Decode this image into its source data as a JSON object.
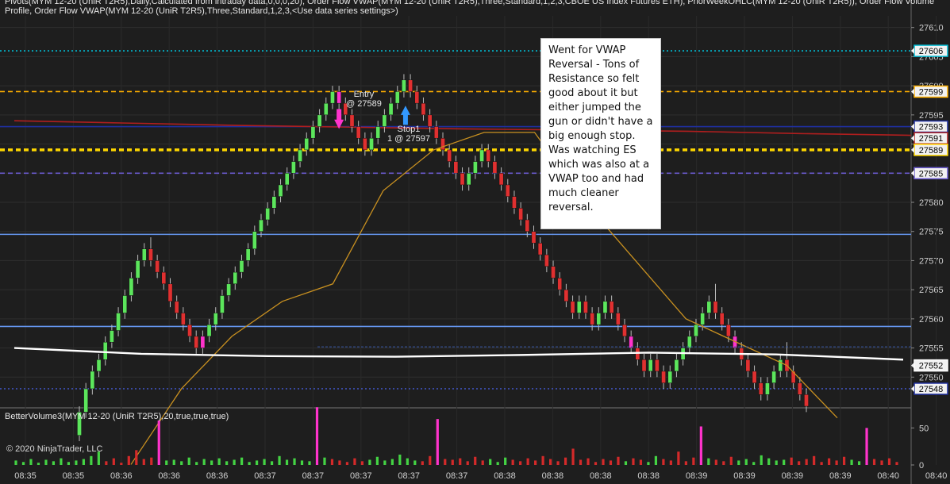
{
  "header": {
    "legend_line1": "Pivots(MYM 12-20 (UniR T2R5),Daily,Calculated from intraday data,0,0,0,20), Order Flow VWAP(MYM 12-20 (UniR T2R5),Three,Standard,1,2,3,CBOE US Index Futures ETH), PriorWeekOHLC(MYM 12-20 (UniR T2R5)), Order Flow Volume",
    "legend_line2": "Profile, Order Flow VWAP(MYM 12-20 (UniR T2R5),Three,Standard,1,2,3,<Use data series settings>)"
  },
  "note": {
    "text": "Went for VWAP Reversal - Tons of Resistance so felt good about it but either jumped the gun or didn't have a big enough stop. Was watching ES which was also at a VWAP too and had much cleaner reversal."
  },
  "annotations": {
    "entry": "Entry\n@ 27589",
    "stop": "Stop1\n1 @ 27597"
  },
  "volume_panel": {
    "title": "BetterVolume3(MYM 12-20 (UniR T2R5),20,true,true,true)"
  },
  "copyright": "© 2020 NinjaTrader, LLC",
  "chart_data": {
    "type": "candlestick",
    "price_axis": {
      "ylim": [
        27545,
        27612
      ],
      "tick_labels": [
        "27610",
        "27605",
        "27600",
        "27595",
        "27590",
        "27585",
        "27580",
        "27575",
        "27570",
        "27565",
        "27560",
        "27555",
        "27550"
      ],
      "ticks": [
        27610,
        27605,
        27600,
        27595,
        27590,
        27585,
        27580,
        27575,
        27570,
        27565,
        27560,
        27555,
        27550
      ]
    },
    "price_markers": [
      {
        "label": "27606",
        "value": 27606,
        "color": "#00bcd4"
      },
      {
        "label": "27599",
        "value": 27599,
        "color": "#ffb000"
      },
      {
        "label": "27593",
        "value": 27593,
        "color": "#1f2fa0"
      },
      {
        "label": "27591",
        "value": 27591,
        "color": "#b22222"
      },
      {
        "label": "27589",
        "value": 27589,
        "color": "#ffd700"
      },
      {
        "label": "27585",
        "value": 27585,
        "color": "#6a5acd"
      },
      {
        "label": "27552",
        "value": 27552,
        "color": "#ffffff"
      },
      {
        "label": "27548",
        "value": 27548,
        "color": "#1f2fa0"
      }
    ],
    "horizontal_lines": [
      {
        "value": 27606,
        "color": "#00bcd4",
        "style": "dotted"
      },
      {
        "value": 27599,
        "color": "#ffb000",
        "style": "dashed"
      },
      {
        "value": 27593,
        "color": "#1f2fa0",
        "style": "solid"
      },
      {
        "value": 27589,
        "color": "#ffd700",
        "style": "dashed-thick"
      },
      {
        "value": 27585,
        "color": "#6a5acd",
        "style": "dashed"
      },
      {
        "value": 27574.5,
        "color": "#6495ed",
        "style": "solid"
      },
      {
        "value": 27558.7,
        "color": "#6495ed",
        "style": "solid"
      },
      {
        "value": 27548,
        "color": "#3f51b5",
        "style": "dotted"
      }
    ],
    "time_labels": [
      "08:35",
      "08:35",
      "08:36",
      "08:36",
      "08:36",
      "08:37",
      "08:37",
      "08:37",
      "08:37",
      "08:37",
      "08:38",
      "08:38",
      "08:38",
      "08:38",
      "08:39",
      "08:39",
      "08:39",
      "08:39",
      "08:40",
      "08:40",
      "08:40"
    ],
    "candles": [
      [
        27540,
        27544,
        27539,
        27545
      ],
      [
        27544,
        27548,
        27543,
        27549
      ],
      [
        27548,
        27551,
        27547,
        27552
      ],
      [
        27551,
        27553,
        27550,
        27554
      ],
      [
        27553,
        27556,
        27552,
        27557
      ],
      [
        27556,
        27558,
        27555,
        27559
      ],
      [
        27558,
        27561,
        27557,
        27562
      ],
      [
        27561,
        27564,
        27560,
        27565
      ],
      [
        27564,
        27567,
        27563,
        27568
      ],
      [
        27567,
        27570,
        27566,
        27571
      ],
      [
        27570,
        27572,
        27569,
        27573
      ],
      [
        27572,
        27570,
        27569,
        27574
      ],
      [
        27570,
        27568,
        27567,
        27571
      ],
      [
        27568,
        27566,
        27565,
        27569
      ],
      [
        27566,
        27563,
        27562,
        27567
      ],
      [
        27563,
        27561,
        27560,
        27564
      ],
      [
        27561,
        27559,
        27558,
        27562
      ],
      [
        27559,
        27557,
        27556,
        27560
      ],
      [
        27557,
        27555,
        27554,
        27558
      ],
      [
        27555,
        27557,
        27554,
        27558
      ],
      [
        27557,
        27559,
        27556,
        27560
      ],
      [
        27559,
        27561,
        27558,
        27562
      ],
      [
        27561,
        27564,
        27560,
        27565
      ],
      [
        27564,
        27566,
        27563,
        27567
      ],
      [
        27566,
        27568,
        27565,
        27569
      ],
      [
        27568,
        27570,
        27567,
        27571
      ],
      [
        27570,
        27572,
        27569,
        27573
      ],
      [
        27572,
        27575,
        27571,
        27576
      ],
      [
        27575,
        27577,
        27574,
        27578
      ],
      [
        27577,
        27579,
        27576,
        27580
      ],
      [
        27579,
        27581,
        27578,
        27582
      ],
      [
        27581,
        27583,
        27580,
        27584
      ],
      [
        27583,
        27585,
        27582,
        27586
      ],
      [
        27585,
        27587,
        27584,
        27588
      ],
      [
        27587,
        27589,
        27586,
        27590
      ],
      [
        27589,
        27591,
        27588,
        27592
      ],
      [
        27591,
        27593,
        27590,
        27594
      ],
      [
        27593,
        27595,
        27592,
        27596
      ],
      [
        27595,
        27597,
        27594,
        27598
      ],
      [
        27597,
        27599,
        27596,
        27600
      ],
      [
        27599,
        27597,
        27596,
        27600
      ],
      [
        27597,
        27595,
        27594,
        27598
      ],
      [
        27595,
        27593,
        27592,
        27596
      ],
      [
        27593,
        27591,
        27590,
        27594
      ],
      [
        27591,
        27589,
        27588,
        27592
      ],
      [
        27589,
        27591,
        27588,
        27592
      ],
      [
        27591,
        27593,
        27590,
        27594
      ],
      [
        27593,
        27595,
        27592,
        27596
      ],
      [
        27595,
        27597,
        27594,
        27598
      ],
      [
        27597,
        27599,
        27596,
        27600
      ],
      [
        27599,
        27601,
        27598,
        27602
      ],
      [
        27601,
        27599,
        27598,
        27602
      ],
      [
        27599,
        27597,
        27596,
        27600
      ],
      [
        27597,
        27595,
        27594,
        27598
      ],
      [
        27595,
        27593,
        27592,
        27596
      ],
      [
        27593,
        27591,
        27590,
        27594
      ],
      [
        27591,
        27589,
        27588,
        27592
      ],
      [
        27589,
        27587,
        27586,
        27590
      ],
      [
        27587,
        27585,
        27584,
        27588
      ],
      [
        27585,
        27583,
        27582,
        27586
      ],
      [
        27583,
        27585,
        27582,
        27586
      ],
      [
        27585,
        27587,
        27584,
        27588
      ],
      [
        27587,
        27589,
        27586,
        27590
      ],
      [
        27589,
        27587,
        27586,
        27590
      ],
      [
        27587,
        27585,
        27584,
        27588
      ],
      [
        27585,
        27583,
        27582,
        27586
      ],
      [
        27583,
        27581,
        27580,
        27584
      ],
      [
        27581,
        27579,
        27578,
        27582
      ],
      [
        27579,
        27577,
        27576,
        27580
      ],
      [
        27577,
        27575,
        27574,
        27578
      ],
      [
        27575,
        27573,
        27572,
        27576
      ],
      [
        27573,
        27571,
        27570,
        27574
      ],
      [
        27571,
        27569,
        27568,
        27572
      ],
      [
        27569,
        27567,
        27566,
        27570
      ],
      [
        27567,
        27565,
        27564,
        27568
      ],
      [
        27565,
        27563,
        27562,
        27566
      ],
      [
        27563,
        27561,
        27560,
        27564
      ],
      [
        27561,
        27563,
        27560,
        27564
      ],
      [
        27563,
        27561,
        27560,
        27564
      ],
      [
        27561,
        27559,
        27558,
        27562
      ],
      [
        27559,
        27561,
        27558,
        27562
      ],
      [
        27561,
        27563,
        27560,
        27564
      ],
      [
        27563,
        27561,
        27560,
        27564
      ],
      [
        27561,
        27559,
        27558,
        27562
      ],
      [
        27559,
        27557,
        27556,
        27560
      ],
      [
        27557,
        27555,
        27554,
        27558
      ],
      [
        27555,
        27553,
        27552,
        27556
      ],
      [
        27553,
        27551,
        27550,
        27554
      ],
      [
        27551,
        27553,
        27550,
        27554
      ],
      [
        27553,
        27551,
        27550,
        27554
      ],
      [
        27551,
        27549,
        27548,
        27552
      ],
      [
        27549,
        27551,
        27548,
        27552
      ],
      [
        27551,
        27553,
        27550,
        27554
      ],
      [
        27553,
        27555,
        27552,
        27556
      ],
      [
        27555,
        27557,
        27554,
        27558
      ],
      [
        27557,
        27559,
        27556,
        27560
      ],
      [
        27559,
        27561,
        27558,
        27562
      ],
      [
        27561,
        27563,
        27560,
        27564
      ],
      [
        27563,
        27561,
        27560,
        27566
      ],
      [
        27561,
        27559,
        27558,
        27562
      ],
      [
        27559,
        27557,
        27556,
        27560
      ],
      [
        27557,
        27555,
        27554,
        27558
      ],
      [
        27555,
        27553,
        27552,
        27556
      ],
      [
        27553,
        27551,
        27550,
        27554
      ],
      [
        27551,
        27549,
        27548,
        27552
      ],
      [
        27549,
        27547,
        27546,
        27550
      ],
      [
        27547,
        27549,
        27546,
        27550
      ],
      [
        27549,
        27551,
        27548,
        27552
      ],
      [
        27551,
        27553,
        27550,
        27554
      ],
      [
        27553,
        27551,
        27550,
        27556
      ],
      [
        27551,
        27549,
        27548,
        27552
      ],
      [
        27549,
        27547,
        27546,
        27550
      ],
      [
        27547,
        27545,
        27544,
        27548
      ]
    ],
    "highlight_candles": [
      19,
      40,
      85,
      101
    ],
    "vwap_white": [
      27555.0,
      27554.0,
      27553.6,
      27553.5,
      27553.8,
      27554.2,
      27553.9,
      27553.0
    ],
    "vwap_orange": [
      27535,
      27548,
      27557,
      27563,
      27566,
      27582,
      27589,
      27592,
      27592,
      27580,
      27570,
      27560,
      27556,
      27552,
      27543
    ],
    "red_line": [
      27594,
      27593.6,
      27593.2,
      27592.9,
      27592.6,
      27592.4,
      27592.2,
      27591.8,
      27591.5
    ],
    "volume_axis": {
      "ylim": [
        0,
        75
      ],
      "tick_labels": [
        "50",
        "0"
      ],
      "ticks": [
        50,
        0
      ]
    },
    "volume": [
      6,
      4,
      8,
      3,
      7,
      5,
      9,
      4,
      6,
      8,
      12,
      18,
      5,
      9,
      3,
      12,
      20,
      8,
      10,
      60,
      6,
      7,
      5,
      10,
      4,
      8,
      6,
      9,
      5,
      7,
      10,
      4,
      6,
      8,
      5,
      12,
      7,
      9,
      6,
      5,
      78,
      10,
      8,
      6,
      4,
      9,
      5,
      7,
      11,
      6,
      8,
      14,
      9,
      6,
      5,
      12,
      62,
      8,
      7,
      9,
      5,
      11,
      6,
      8,
      4,
      10,
      7,
      5,
      9,
      6,
      12,
      8,
      5,
      10,
      22,
      7,
      9,
      4,
      8,
      6,
      11,
      5,
      9,
      7,
      4,
      12,
      8,
      6,
      18,
      5,
      10,
      52,
      9,
      7,
      5,
      11,
      6,
      8,
      4,
      13,
      9,
      6,
      7,
      10,
      5,
      8,
      12,
      4,
      9,
      6,
      11,
      7,
      5,
      50,
      8,
      6,
      9,
      4
    ],
    "volume_colors_red_up": true
  }
}
